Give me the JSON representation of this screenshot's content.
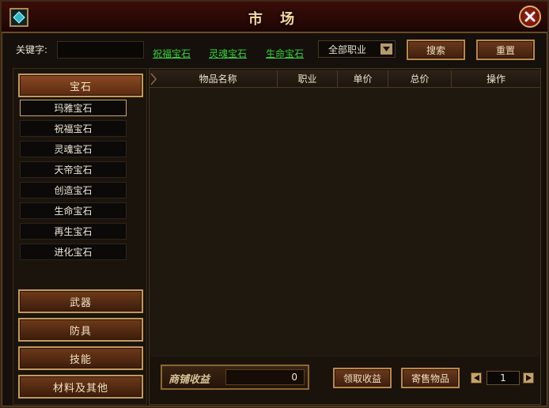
{
  "window": {
    "title": "市 场"
  },
  "search": {
    "keyword_label": "关键字:",
    "keyword_value": "",
    "quick_links": [
      "祝福宝石",
      "灵魂宝石",
      "生命宝石"
    ],
    "class_select": "全部职业",
    "search_label": "搜索",
    "reset_label": "重置"
  },
  "sidebar": {
    "gem_category": "宝石",
    "gem_items": [
      "玛雅宝石",
      "祝福宝石",
      "灵魂宝石",
      "天帝宝石",
      "创造宝石",
      "生命宝石",
      "再生宝石",
      "进化宝石"
    ],
    "selected_gem": "玛雅宝石",
    "categories": [
      "武器",
      "防具",
      "技能",
      "材料及其他"
    ]
  },
  "table": {
    "columns": [
      "物品名称",
      "职业",
      "单价",
      "总价",
      "操作"
    ],
    "rows": []
  },
  "footer": {
    "income_label": "商铺收益",
    "income_value": "0",
    "collect_label": "领取收益",
    "consign_label": "寄售物品",
    "page": "1"
  },
  "colors": {
    "link_green": "#39d23a",
    "title_gold": "#f3d9a0",
    "panel_brown": "#1f180f"
  },
  "icons": {
    "corner": "gem-icon",
    "close": "close-icon",
    "dropdown": "chevron-down-icon",
    "pager_prev": "triangle-left-icon",
    "pager_next": "triangle-right-icon"
  }
}
